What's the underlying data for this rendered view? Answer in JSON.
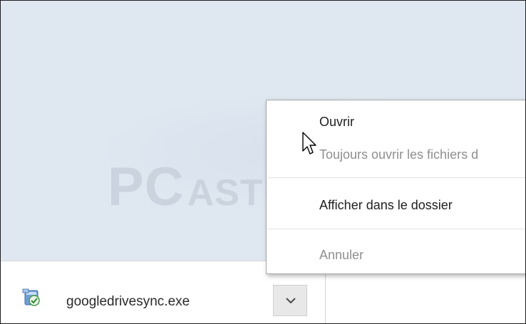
{
  "watermark": {
    "brand_primary": "PC",
    "brand_secondary": "ASTUCES"
  },
  "download": {
    "file_name": "googledrivesync.exe",
    "file_icon": "installer-icon",
    "menu_button_icon": "chevron-down-icon"
  },
  "context_menu": {
    "items": [
      {
        "label": "Ouvrir",
        "enabled": true
      },
      {
        "label": "Toujours ouvrir les fichiers d",
        "enabled": false
      },
      {
        "label": "Afficher dans le dossier",
        "enabled": true
      },
      {
        "label": "Annuler",
        "enabled": false
      }
    ]
  },
  "colors": {
    "page_background": "#dfe7f1",
    "menu_text": "#1e1e1e",
    "menu_text_disabled": "#8f8f8f"
  }
}
